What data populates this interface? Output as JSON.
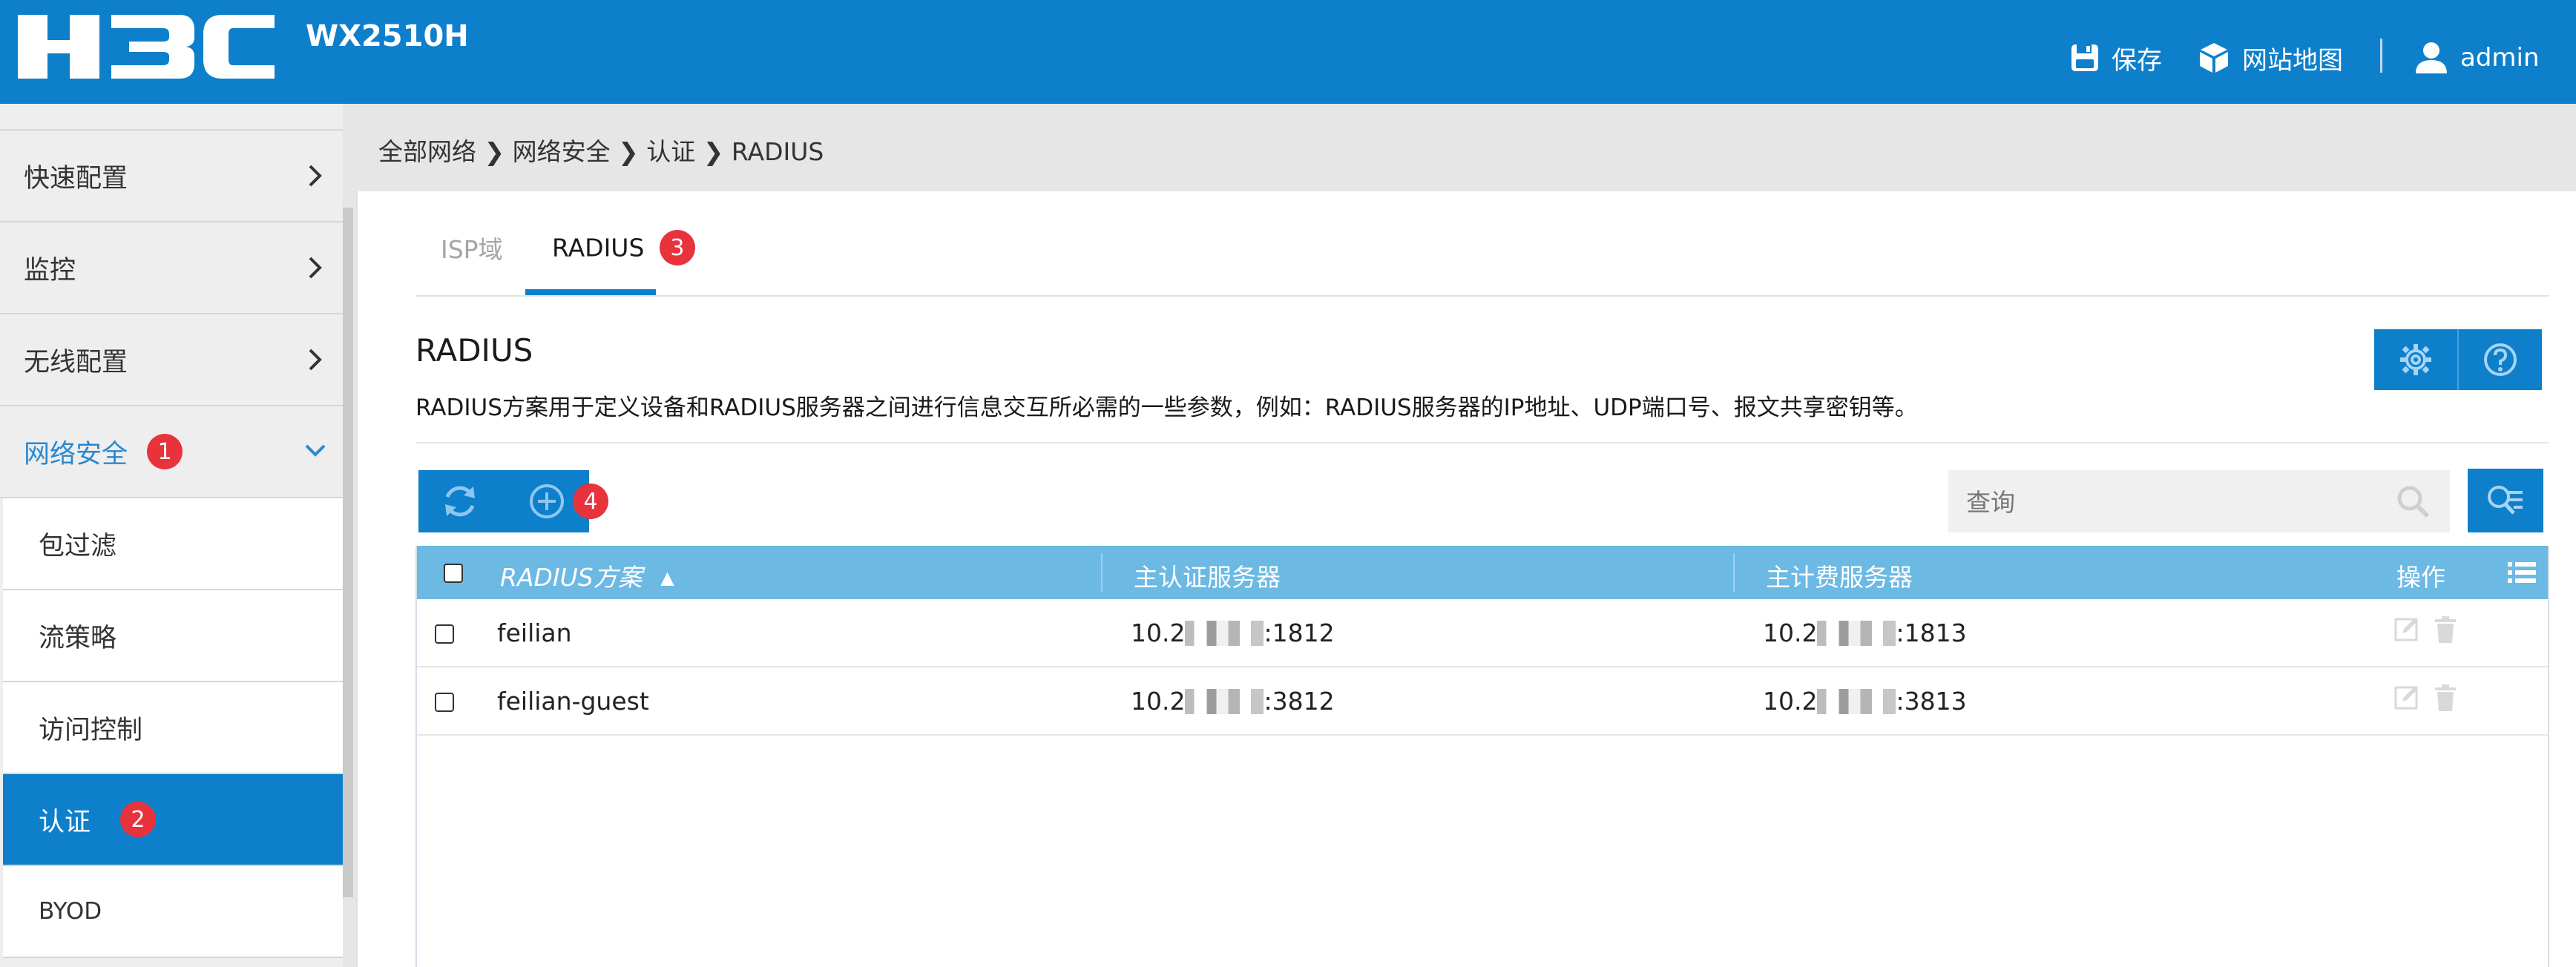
{
  "header": {
    "logo_text": "H3C",
    "model": "WX2510H",
    "save_label": "保存",
    "sitemap_label": "网站地图",
    "user_label": "admin",
    "bg_color": "#0e7fcb"
  },
  "sidebar": {
    "items": [
      {
        "label": "快速配置",
        "icon": "chevron-right-icon"
      },
      {
        "label": "监控",
        "icon": "chevron-right-icon"
      },
      {
        "label": "无线配置",
        "icon": "chevron-right-icon"
      },
      {
        "label": "网络安全",
        "icon": "chevron-down-icon",
        "badge": "1",
        "expanded": true
      }
    ],
    "subitems": [
      {
        "label": "包过滤"
      },
      {
        "label": "流策略"
      },
      {
        "label": "访问控制"
      },
      {
        "label": "认证",
        "badge": "2",
        "active": true
      },
      {
        "label": "BYOD"
      }
    ],
    "active_color": "#0e7fcb",
    "expanded_color": "#2a88d0"
  },
  "breadcrumb": {
    "parts": [
      "全部网络",
      "网络安全",
      "认证",
      "RADIUS"
    ]
  },
  "tabs": [
    {
      "label": "ISP域",
      "active": false
    },
    {
      "label": "RADIUS",
      "active": true,
      "badge": "3"
    }
  ],
  "section": {
    "title": "RADIUS",
    "description": "RADIUS方案用于定义设备和RADIUS服务器之间进行信息交互所必需的一些参数，例如：RADIUS服务器的IP地址、UDP端口号、报文共享密钥等。"
  },
  "toolbar": {
    "refresh_icon": "refresh-icon",
    "add_icon": "add-circle-icon",
    "add_badge": "4",
    "settings_icon": "gear-icon",
    "help_icon": "help-icon",
    "advanced_search_icon": "advanced-search-icon"
  },
  "search": {
    "placeholder": "查询"
  },
  "table": {
    "columns": [
      "RADIUS方案",
      "主认证服务器",
      "主计费服务器",
      "操作"
    ],
    "sort_indicator": "▲",
    "header_color": "#6cb9e4",
    "rows": [
      {
        "scheme": "feilian",
        "auth_prefix": "10.2",
        "auth_suffix": ":1812",
        "acct_prefix": "10.2",
        "acct_suffix": ":1813"
      },
      {
        "scheme": "feilian-guest",
        "auth_prefix": "10.2",
        "auth_suffix": ":3812",
        "acct_prefix": "10.2",
        "acct_suffix": ":3813"
      }
    ]
  },
  "badge_color": "#e8323c"
}
